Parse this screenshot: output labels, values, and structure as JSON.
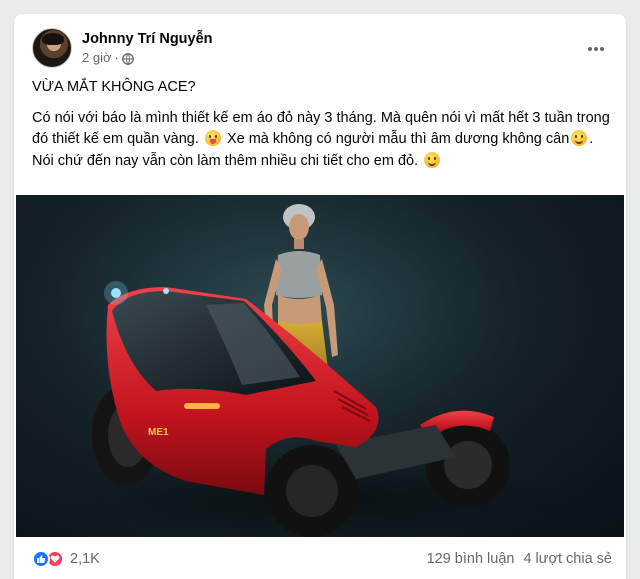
{
  "post": {
    "author_name": "Johnny Trí Nguyễn",
    "time": "2 giờ",
    "privacy_icon": "globe-icon",
    "more_icon": "more-options-icon",
    "title": "VỪA MẮT KHÔNG ACE?",
    "body_part1": "Có nói với báo là mình thiết kế em áo đỏ này 3 tháng.  Mà quên nói vì mất hết 3 tuần trong đó thiết kế em quần vàng.",
    "body_part2": "Xe mà không có người mẫu thì âm dương không cân",
    "body_part3": "Nói chứ đến nay vẫn còn làm thêm nhiều chi tiết cho em đỏ.",
    "emojis": [
      "tongue-emoji",
      "smile-emoji",
      "smile-emoji"
    ],
    "image": {
      "description_icon": "vehicle-photo",
      "vehicle_badge": "ME1"
    }
  },
  "footer": {
    "reaction_icons": [
      "like-icon",
      "love-icon"
    ],
    "reaction_count": "2,1K",
    "comments": "129 bình luận",
    "shares": "4 lượt chia sẻ"
  },
  "colors": {
    "background": "#e9ebee",
    "card": "#ffffff",
    "secondary_text": "#65676b",
    "like_blue": "#1877f2",
    "love_red": "#f33e58",
    "vehicle_red": "#d9222a",
    "pants_yellow": "#c9a227"
  }
}
